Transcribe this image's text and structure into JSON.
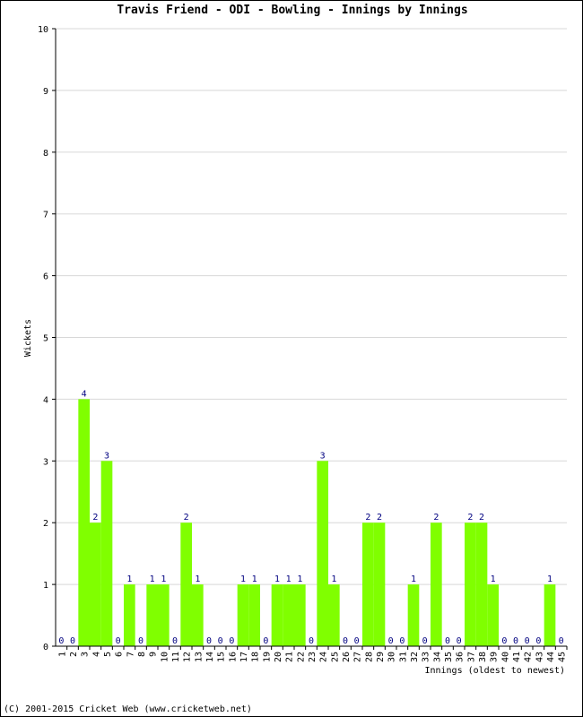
{
  "chart_data": {
    "type": "bar",
    "title": "Travis Friend - ODI - Bowling - Innings by Innings",
    "xlabel": "Innings (oldest to newest)",
    "ylabel": "Wickets",
    "ylim": [
      0,
      10
    ],
    "yticks": [
      0,
      1,
      2,
      3,
      4,
      5,
      6,
      7,
      8,
      9,
      10
    ],
    "grid": true,
    "bar_color": "#80ff00",
    "label_color": "#000080",
    "categories": [
      "1",
      "2",
      "3",
      "4",
      "5",
      "6",
      "7",
      "8",
      "9",
      "10",
      "11",
      "12",
      "13",
      "14",
      "15",
      "16",
      "17",
      "18",
      "19",
      "20",
      "21",
      "22",
      "23",
      "24",
      "25",
      "26",
      "27",
      "28",
      "29",
      "30",
      "31",
      "32",
      "33",
      "34",
      "35",
      "36",
      "37",
      "38",
      "39",
      "40",
      "41",
      "42",
      "43",
      "44",
      "45"
    ],
    "values": [
      0,
      0,
      4,
      2,
      3,
      0,
      1,
      0,
      1,
      1,
      0,
      2,
      1,
      0,
      0,
      0,
      1,
      1,
      0,
      1,
      1,
      1,
      0,
      3,
      1,
      0,
      0,
      2,
      2,
      0,
      0,
      1,
      0,
      2,
      0,
      0,
      2,
      2,
      1,
      0,
      0,
      0,
      0,
      1,
      0
    ]
  },
  "footer": "(C) 2001-2015 Cricket Web (www.cricketweb.net)"
}
